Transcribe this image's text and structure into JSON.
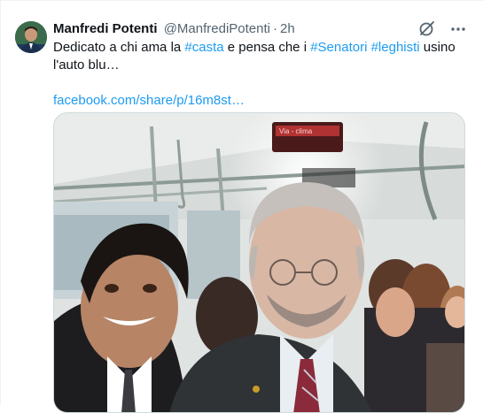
{
  "tweet": {
    "author_name": "Manfredi Potenti",
    "handle": "@ManfrediPotenti",
    "separator": "·",
    "time": "2h",
    "text_1": "Dedicato a chi ama la ",
    "tag_1": "#casta",
    "text_2": " e pensa che i ",
    "tag_2": "#Senatori",
    "text_3": " ",
    "tag_3": "#leghisti",
    "text_4": " usino l'auto blu…",
    "link": "facebook.com/share/p/16m8st…"
  },
  "bus_display": {
    "line1": "Via - clima"
  },
  "icons": {
    "grok": "grok-icon",
    "more": "more-icon"
  },
  "colors": {
    "link": "#1d9bf0",
    "secondary_text": "#536471",
    "primary_text": "#0f1419"
  }
}
